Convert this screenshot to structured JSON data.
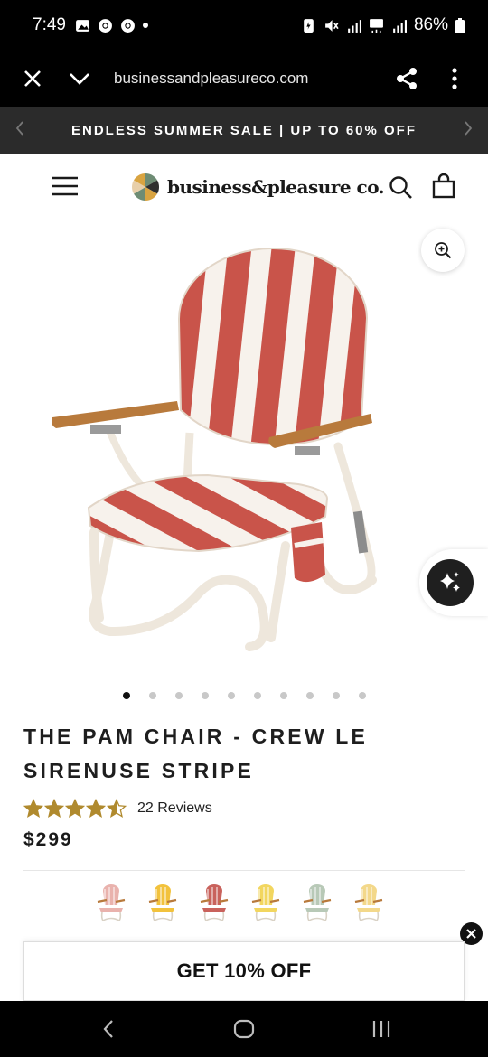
{
  "status_bar": {
    "time": "7:49",
    "battery": "86%"
  },
  "browser": {
    "url": "businessandpleasureco.com"
  },
  "promo": {
    "text": "ENDLESS SUMMER SALE | UP TO 60% OFF"
  },
  "header": {
    "logo_text": "business&pleasure co."
  },
  "product": {
    "title": "THE PAM CHAIR - CREW LE SIRENUSE STRIPE",
    "rating": 4.5,
    "reviews": "22 Reviews",
    "price": "$299",
    "image_count": 10,
    "active_image": 1,
    "swatch_colors": [
      "#e9b2ad",
      "#f2c23c",
      "#c9625c",
      "#f2d65f",
      "#b8c9b7",
      "#f3d88a"
    ]
  },
  "offer": {
    "label": "GET 10% OFF"
  },
  "colors": {
    "promo_bg": "#2b2b2b",
    "stripe": "#c9544a",
    "star": "#b08a2e",
    "wood": "#b87a3c"
  }
}
